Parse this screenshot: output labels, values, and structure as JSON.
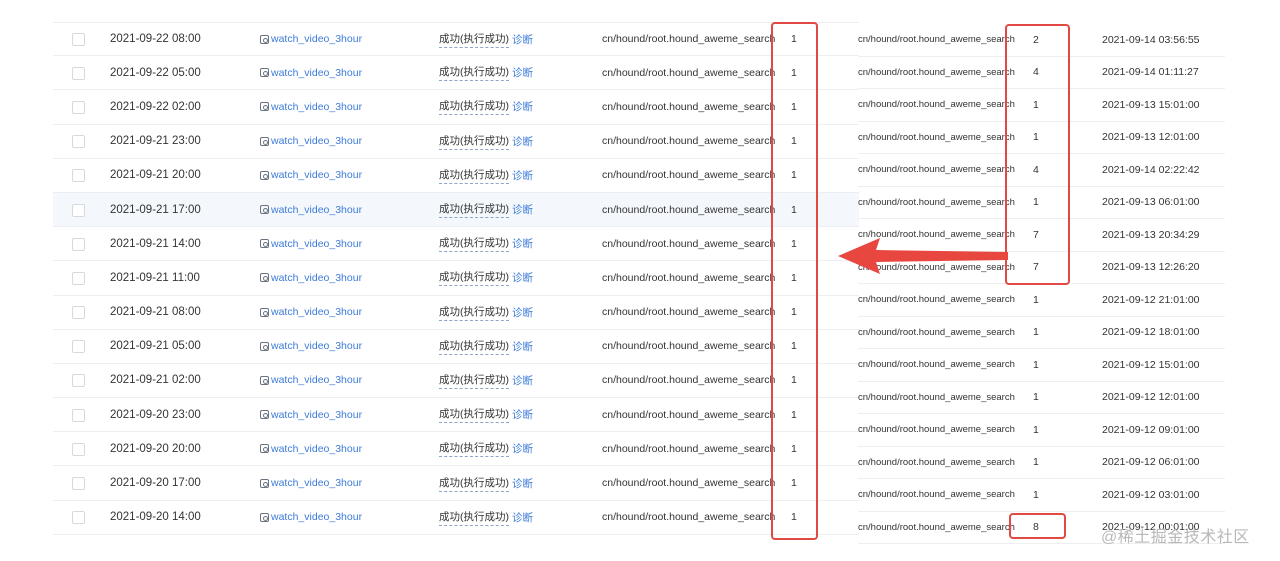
{
  "left_table": {
    "rows": [
      {
        "time": "2021-09-22 08:00",
        "task": "watch_video_3hour",
        "status": "成功(执行成功)",
        "diagnose": "诊断",
        "path": "cn/hound/root.hound_aweme_search",
        "count": "1"
      },
      {
        "time": "2021-09-22 05:00",
        "task": "watch_video_3hour",
        "status": "成功(执行成功)",
        "diagnose": "诊断",
        "path": "cn/hound/root.hound_aweme_search",
        "count": "1"
      },
      {
        "time": "2021-09-22 02:00",
        "task": "watch_video_3hour",
        "status": "成功(执行成功)",
        "diagnose": "诊断",
        "path": "cn/hound/root.hound_aweme_search",
        "count": "1"
      },
      {
        "time": "2021-09-21 23:00",
        "task": "watch_video_3hour",
        "status": "成功(执行成功)",
        "diagnose": "诊断",
        "path": "cn/hound/root.hound_aweme_search",
        "count": "1"
      },
      {
        "time": "2021-09-21 20:00",
        "task": "watch_video_3hour",
        "status": "成功(执行成功)",
        "diagnose": "诊断",
        "path": "cn/hound/root.hound_aweme_search",
        "count": "1"
      },
      {
        "time": "2021-09-21 17:00",
        "task": "watch_video_3hour",
        "status": "成功(执行成功)",
        "diagnose": "诊断",
        "path": "cn/hound/root.hound_aweme_search",
        "count": "1"
      },
      {
        "time": "2021-09-21 14:00",
        "task": "watch_video_3hour",
        "status": "成功(执行成功)",
        "diagnose": "诊断",
        "path": "cn/hound/root.hound_aweme_search",
        "count": "1"
      },
      {
        "time": "2021-09-21 11:00",
        "task": "watch_video_3hour",
        "status": "成功(执行成功)",
        "diagnose": "诊断",
        "path": "cn/hound/root.hound_aweme_search",
        "count": "1"
      },
      {
        "time": "2021-09-21 08:00",
        "task": "watch_video_3hour",
        "status": "成功(执行成功)",
        "diagnose": "诊断",
        "path": "cn/hound/root.hound_aweme_search",
        "count": "1"
      },
      {
        "time": "2021-09-21 05:00",
        "task": "watch_video_3hour",
        "status": "成功(执行成功)",
        "diagnose": "诊断",
        "path": "cn/hound/root.hound_aweme_search",
        "count": "1"
      },
      {
        "time": "2021-09-21 02:00",
        "task": "watch_video_3hour",
        "status": "成功(执行成功)",
        "diagnose": "诊断",
        "path": "cn/hound/root.hound_aweme_search",
        "count": "1"
      },
      {
        "time": "2021-09-20 23:00",
        "task": "watch_video_3hour",
        "status": "成功(执行成功)",
        "diagnose": "诊断",
        "path": "cn/hound/root.hound_aweme_search",
        "count": "1"
      },
      {
        "time": "2021-09-20 20:00",
        "task": "watch_video_3hour",
        "status": "成功(执行成功)",
        "diagnose": "诊断",
        "path": "cn/hound/root.hound_aweme_search",
        "count": "1"
      },
      {
        "time": "2021-09-20 17:00",
        "task": "watch_video_3hour",
        "status": "成功(执行成功)",
        "diagnose": "诊断",
        "path": "cn/hound/root.hound_aweme_search",
        "count": "1"
      },
      {
        "time": "2021-09-20 14:00",
        "task": "watch_video_3hour",
        "status": "成功(执行成功)",
        "diagnose": "诊断",
        "path": "cn/hound/root.hound_aweme_search",
        "count": "1"
      }
    ]
  },
  "right_table": {
    "rows": [
      {
        "path": "cn/hound/root.hound_aweme_search",
        "count": "2",
        "time": "2021-09-14 03:56:55"
      },
      {
        "path": "cn/hound/root.hound_aweme_search",
        "count": "4",
        "time": "2021-09-14 01:11:27"
      },
      {
        "path": "cn/hound/root.hound_aweme_search",
        "count": "1",
        "time": "2021-09-13 15:01:00"
      },
      {
        "path": "cn/hound/root.hound_aweme_search",
        "count": "1",
        "time": "2021-09-13 12:01:00"
      },
      {
        "path": "cn/hound/root.hound_aweme_search",
        "count": "4",
        "time": "2021-09-14 02:22:42"
      },
      {
        "path": "cn/hound/root.hound_aweme_search",
        "count": "1",
        "time": "2021-09-13 06:01:00"
      },
      {
        "path": "cn/hound/root.hound_aweme_search",
        "count": "7",
        "time": "2021-09-13 20:34:29"
      },
      {
        "path": "cn/hound/root.hound_aweme_search",
        "count": "7",
        "time": "2021-09-13 12:26:20"
      },
      {
        "path": "cn/hound/root.hound_aweme_search",
        "count": "1",
        "time": "2021-09-12 21:01:00"
      },
      {
        "path": "cn/hound/root.hound_aweme_search",
        "count": "1",
        "time": "2021-09-12 18:01:00"
      },
      {
        "path": "cn/hound/root.hound_aweme_search",
        "count": "1",
        "time": "2021-09-12 15:01:00"
      },
      {
        "path": "cn/hound/root.hound_aweme_search",
        "count": "1",
        "time": "2021-09-12 12:01:00"
      },
      {
        "path": "cn/hound/root.hound_aweme_search",
        "count": "1",
        "time": "2021-09-12 09:01:00"
      },
      {
        "path": "cn/hound/root.hound_aweme_search",
        "count": "1",
        "time": "2021-09-12 06:01:00"
      },
      {
        "path": "cn/hound/root.hound_aweme_search",
        "count": "1",
        "time": "2021-09-12 03:01:00"
      },
      {
        "path": "cn/hound/root.hound_aweme_search",
        "count": "8",
        "time": "2021-09-12 00:01:00"
      }
    ]
  },
  "annotation": {
    "color": "#e04a43"
  },
  "icons": {
    "task_icon": "task-type-icon",
    "arrow": "arrow-left-icon"
  },
  "watermark": "@稀土掘金技术社区"
}
